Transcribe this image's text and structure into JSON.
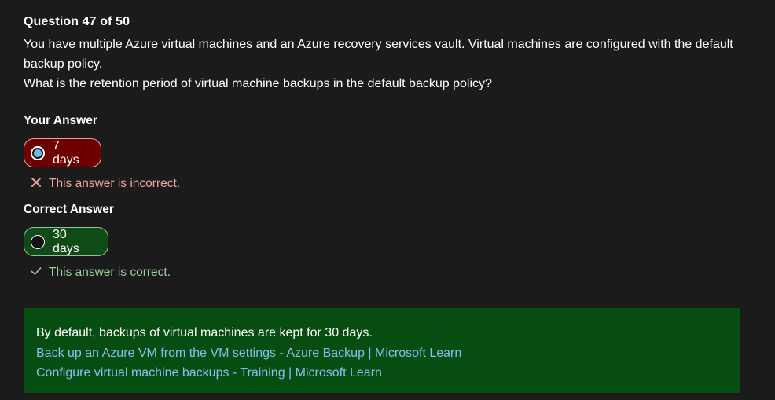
{
  "question": {
    "number_label": "Question 47 of 50",
    "text_line1": "You have multiple Azure virtual machines and an Azure recovery services vault. Virtual machines are configured with the default backup policy.",
    "text_line2": "What is the retention period of virtual machine backups in the default backup policy?"
  },
  "your_answer": {
    "label": "Your Answer",
    "choice": "7 days",
    "feedback": "This answer is incorrect.",
    "feedback_icon": "x-icon"
  },
  "correct_answer": {
    "label": "Correct Answer",
    "choice": "30 days",
    "feedback": "This answer is correct.",
    "feedback_icon": "check-icon"
  },
  "explanation": {
    "text": "By default, backups of virtual machines are kept for 30 days.",
    "links": [
      "Back up an Azure VM from the VM settings - Azure Backup | Microsoft Learn",
      "Configure virtual machine backups - Training | Microsoft Learn"
    ]
  },
  "colors": {
    "background": "#1b1b1b",
    "wrong_bg": "#6e0000",
    "right_bg": "#0f4a17",
    "explanation_bg": "#074d12",
    "link": "#7fc2f0"
  }
}
